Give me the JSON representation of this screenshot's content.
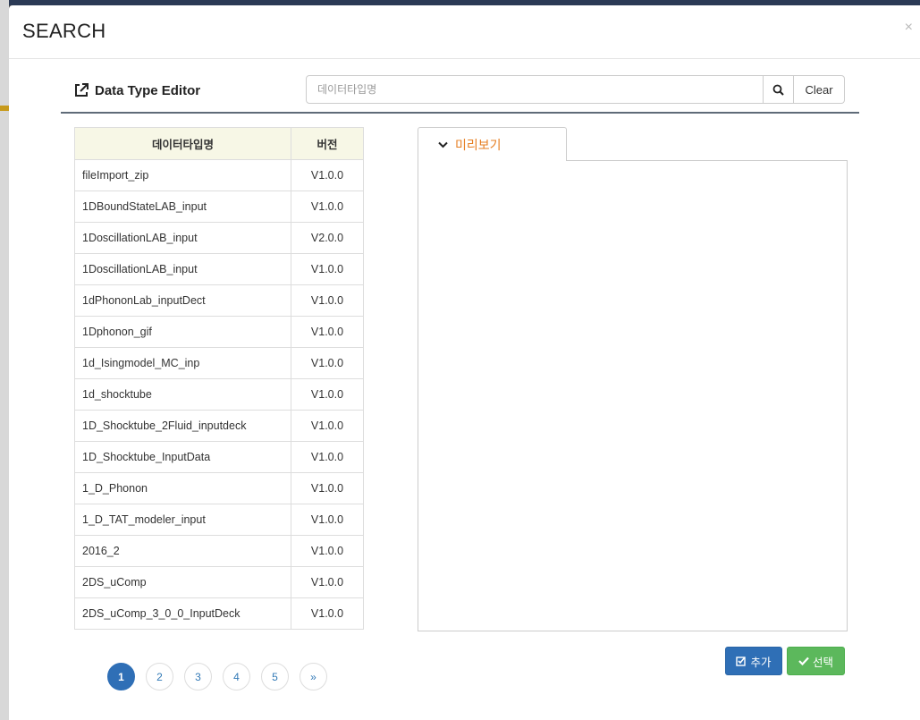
{
  "modal": {
    "title": "SEARCH",
    "close_label": "×"
  },
  "editor": {
    "title": "Data Type Editor",
    "search_placeholder": "데이터타입명",
    "clear_label": "Clear"
  },
  "table": {
    "headers": {
      "name": "데이터타입명",
      "version": "버전"
    },
    "rows": [
      {
        "name": "fileImport_zip",
        "version": "V1.0.0"
      },
      {
        "name": "1DBoundStateLAB_input",
        "version": "V1.0.0"
      },
      {
        "name": "1DoscillationLAB_input",
        "version": "V2.0.0"
      },
      {
        "name": "1DoscillationLAB_input",
        "version": "V1.0.0"
      },
      {
        "name": "1dPhononLab_inputDect",
        "version": "V1.0.0"
      },
      {
        "name": "1Dphonon_gif",
        "version": "V1.0.0"
      },
      {
        "name": "1d_Isingmodel_MC_inp",
        "version": "V1.0.0"
      },
      {
        "name": "1d_shocktube",
        "version": "V1.0.0"
      },
      {
        "name": "1D_Shocktube_2Fluid_inputdeck",
        "version": "V1.0.0"
      },
      {
        "name": "1D_Shocktube_InputData",
        "version": "V1.0.0"
      },
      {
        "name": "1_D_Phonon",
        "version": "V1.0.0"
      },
      {
        "name": "1_D_TAT_modeler_input",
        "version": "V1.0.0"
      },
      {
        "name": "2016_2",
        "version": "V1.0.0"
      },
      {
        "name": "2DS_uComp",
        "version": "V1.0.0"
      },
      {
        "name": "2DS_uComp_3_0_0_InputDeck",
        "version": "V1.0.0"
      }
    ]
  },
  "preview": {
    "tab_label": "미리보기"
  },
  "pagination": {
    "pages": [
      "1",
      "2",
      "3",
      "4",
      "5"
    ],
    "next_label": "»",
    "active": "1"
  },
  "actions": {
    "add_label": "추가",
    "select_label": "선택"
  },
  "colors": {
    "primary": "#2f6fb6",
    "success": "#5cb85c",
    "accent": "#e67e22",
    "table_header_bg": "#f7f7e6"
  }
}
